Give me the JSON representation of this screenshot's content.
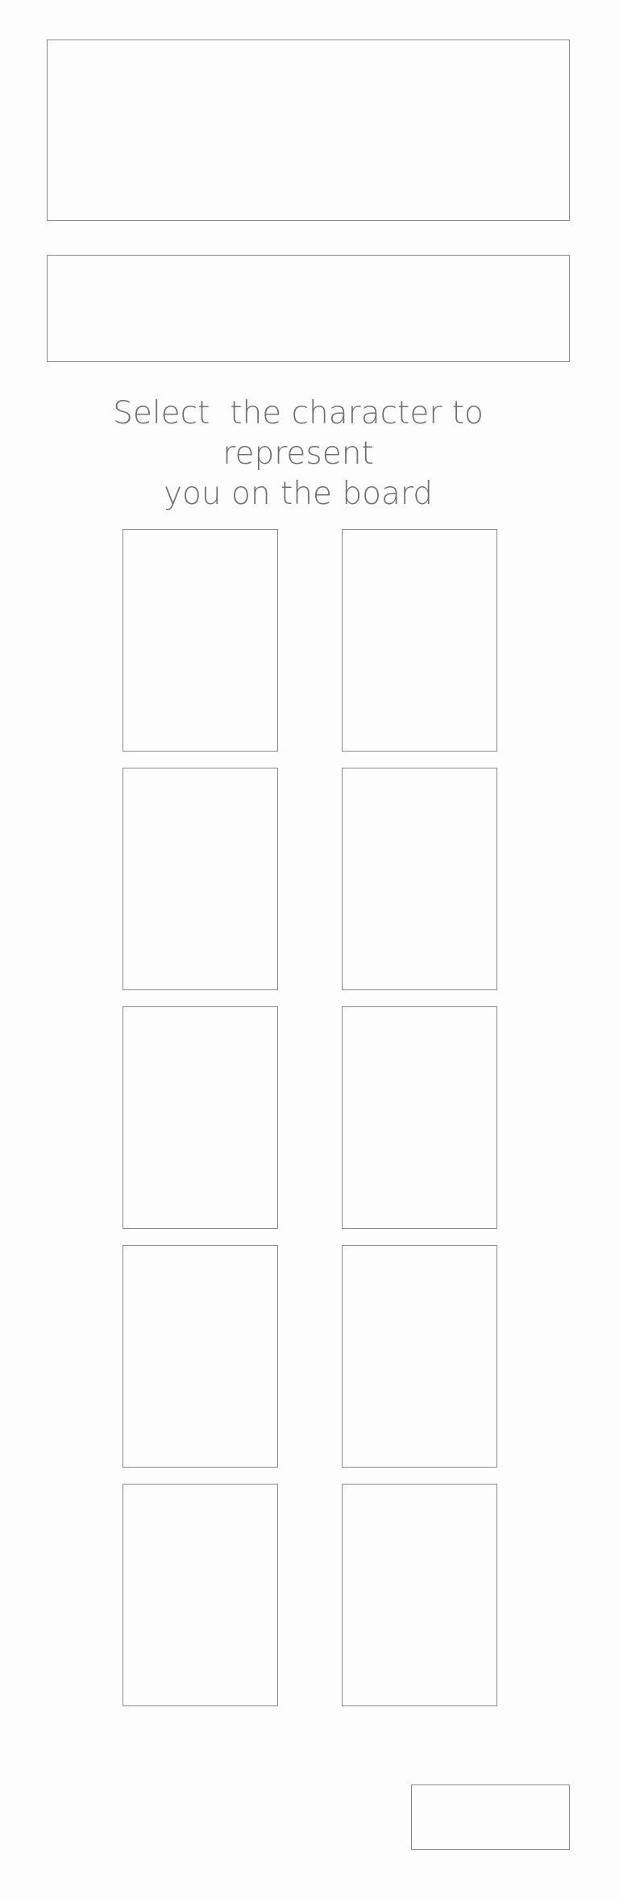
{
  "prompt": {
    "line1": "Select  the character to represent",
    "line2": "you on the board"
  },
  "characters": {
    "count_rows": 5,
    "count_cols": 2
  }
}
